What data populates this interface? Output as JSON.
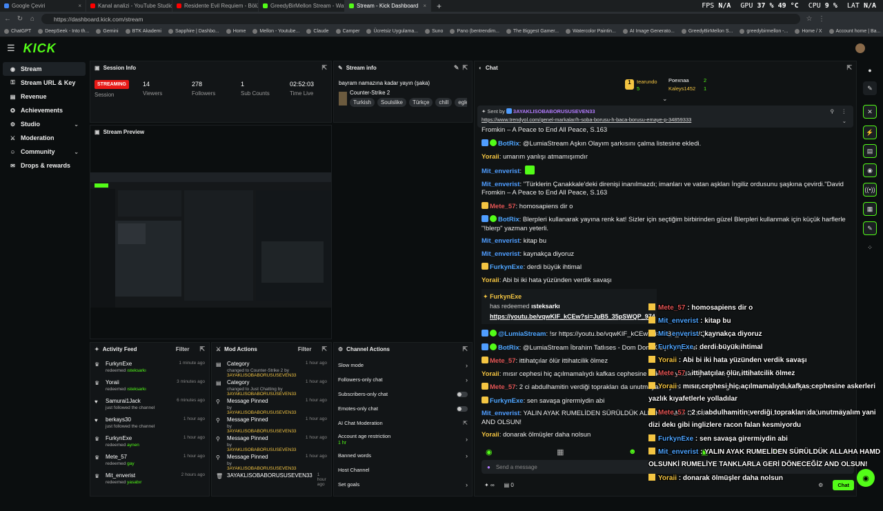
{
  "browser": {
    "tabs": [
      {
        "label": "Google Çeviri",
        "color": "#4285f4"
      },
      {
        "label": "Kanal analizi - YouTube Studio",
        "color": "#ff0000"
      },
      {
        "label": "Residente Evil Requiem - Bölüm 4",
        "color": "#ff0000"
      },
      {
        "label": "GreedyBirMellon Stream - Watch",
        "color": "#53fc18"
      },
      {
        "label": "Stream - Kick Dashboard",
        "color": "#53fc18"
      }
    ],
    "new_tab": "+",
    "url": "https://dashboard.kick.com/stream",
    "hud": {
      "fps_label": "FPS",
      "fps_value": "N/A",
      "gpu_label": "GPU",
      "gpu_value": "37 %  49 °C",
      "cpu_label": "CPU",
      "cpu_value": "9 %",
      "lat_label": "LAT",
      "lat_value": "N/A"
    },
    "bookmarks": [
      "ChatGPT",
      "DeepSeek - Into th...",
      "Gemini",
      "BTK Akademi",
      "Sapphire | Dashbo...",
      "Home",
      "Mellon - Youtube...",
      "Claude",
      "Camper",
      "Ücretsiz Uygulama...",
      "Suno",
      "Pano (bentrendim...",
      "The Biggest Gamer...",
      "Watercolor Paintin...",
      "AI Image Generato...",
      "GreedyBirMellon S...",
      "greedybirmellon -...",
      "Home / X",
      "Account home | Ba..."
    ]
  },
  "kick": {
    "logo": "KICK"
  },
  "sidebar": {
    "items": [
      {
        "label": "Stream",
        "icon": "stream-icon"
      },
      {
        "label": "Stream URL & Key",
        "icon": "key-icon"
      },
      {
        "label": "Revenue",
        "icon": "revenue-icon"
      },
      {
        "label": "Achievements",
        "icon": "trophy-icon"
      },
      {
        "label": "Studio",
        "icon": "studio-icon"
      },
      {
        "label": "Moderation",
        "icon": "sword-icon"
      },
      {
        "label": "Community",
        "icon": "community-icon"
      },
      {
        "label": "Drops & rewards",
        "icon": "gift-icon"
      }
    ]
  },
  "session_info": {
    "title": "Session Info",
    "live_badge": "STREAMING",
    "session_label": "Session",
    "viewers_value": "14",
    "viewers_label": "Viewers",
    "followers_value": "278",
    "followers_label": "Followers",
    "subs_value": "1",
    "subs_label": "Sub Counts",
    "time_value": "02:52:03",
    "time_label": "Time Live"
  },
  "stream_info": {
    "title": "Stream info",
    "stream_title": "bayram namazına kadar yayın (şaka)",
    "category": "Counter-Strike 2",
    "tags": [
      "Turkish",
      "Soulslike",
      "Türkçe",
      "chill",
      "eglenc"
    ]
  },
  "stream_preview": {
    "title": "Stream Preview"
  },
  "activity_feed": {
    "title": "Activity Feed",
    "filter": "Filter",
    "items": [
      {
        "name": "FurkynExe",
        "action": "redeemed",
        "detail": "ısteksarkı",
        "time": "1 minute ago"
      },
      {
        "name": "Yoraii",
        "action": "redeemed",
        "detail": "ısteksarkı",
        "time": "3 minutes ago"
      },
      {
        "name": "Samurai1Jack",
        "action": "just followed the channel",
        "detail": "",
        "time": "6 minutes ago"
      },
      {
        "name": "berkays30",
        "action": "just followed the channel",
        "detail": "",
        "time": "1 hour ago"
      },
      {
        "name": "FurkynExe",
        "action": "redeemed",
        "detail": "aynen",
        "time": "1 hour ago"
      },
      {
        "name": "Mete_57",
        "action": "redeemed",
        "detail": "gay",
        "time": "1 hour ago"
      },
      {
        "name": "Mit_enverist",
        "action": "redeemed",
        "detail": "yasabır",
        "time": "2 hours ago"
      }
    ]
  },
  "mod_actions": {
    "title": "Mod Actions",
    "filter": "Filter",
    "items": [
      {
        "name": "Category",
        "line": "changed to Counter-Strike 2 by",
        "by": "3AYAKLISOBABORUSUSEVEN33",
        "time": "1 hour ago"
      },
      {
        "name": "Category",
        "line": "changed to Just Chatting by",
        "by": "3AYAKLISOBABORUSUSEVEN33",
        "time": "1 hour ago"
      },
      {
        "name": "Message Pinned",
        "line": "by",
        "by": "3AYAKLISOBABORUSUSEVEN33",
        "time": "1 hour ago"
      },
      {
        "name": "Message Pinned",
        "line": "by",
        "by": "3AYAKLISOBABORUSUSEVEN33",
        "time": "1 hour ago"
      },
      {
        "name": "Message Pinned",
        "line": "by",
        "by": "3AYAKLISOBABORUSUSEVEN33",
        "time": "1 hour ago"
      },
      {
        "name": "Message Pinned",
        "line": "by",
        "by": "3AYAKLISOBABORUSUSEVEN33",
        "time": "1 hour ago"
      },
      {
        "name": "3AYAKLISOBABORUSUSEVEN33",
        "line": "",
        "by": "",
        "time": "1 hour ago"
      }
    ]
  },
  "channel_actions": {
    "title": "Channel Actions",
    "slow_mode": "Slow mode",
    "followers_only": "Followers-only chat",
    "subscribers_only": "Subscribers-only chat",
    "emotes_only": "Emotes-only chat",
    "ai_moderation": "AI Chat Moderation",
    "age_restriction": "Account age restriction",
    "age_value": "1 hr",
    "banned_words": "Banned words",
    "host_channel": "Host Channel",
    "set_goals": "Set goals"
  },
  "chat": {
    "title": "Chat",
    "leaderboard": [
      {
        "name": "tearundo",
        "score": "5"
      },
      {
        "name": "Poexnaa",
        "score": "2"
      },
      {
        "name": "Kaleys1452",
        "score": "1"
      }
    ],
    "pinned": {
      "sent_by": "Sent by",
      "user": "3AYAKLISOBABORUSUSEVEN33",
      "link": "https://www.trendyol.com/genel-markalar/h-soba-borusu-h-baca-borusu-emaye-p-34859333"
    },
    "truncated_line": "Fromkin – A Peace to End All Peace, S.163",
    "messages": [
      {
        "user": "BotRix",
        "cls": "g",
        "badge": "bot",
        "text": "@LumiaStream Aşkın Olayım şarkısını çalma listesine ekledi."
      },
      {
        "user": "Yoraii",
        "cls": "y",
        "badge": "",
        "text": "umarım yanlışı atmamışımdır"
      },
      {
        "user": "Mit_enverist",
        "cls": "b",
        "badge": "",
        "text": "[emote]"
      },
      {
        "user": "Mit_enverist",
        "cls": "b",
        "badge": "",
        "text": "\"Türklerin Çanakkale'deki direnişi inanılmazdı; imanları ve vatan aşkları İngiliz ordusunu şaşkına çevirdi.\"David Fromkin – A Peace to End All Peace, S.163"
      },
      {
        "user": "Mete_57",
        "cls": "r",
        "badge": "crown",
        "text": "homosapiens dir o"
      },
      {
        "user": "BotRix",
        "cls": "g",
        "badge": "bot",
        "text": "Blerpleri kullanarak yayına renk kat! Sizler için seçtiğim birbirinden güzel Blerpleri kullanmak için küçük harflerle \"!blerp\" yazman yeterli."
      },
      {
        "user": "Mit_enverist",
        "cls": "b",
        "badge": "",
        "text": "kitap bu"
      },
      {
        "user": "Mit_enverist",
        "cls": "b",
        "badge": "",
        "text": "kaynakça diyoruz"
      },
      {
        "user": "FurkynExe",
        "cls": "g",
        "badge": "crown",
        "text": "derdi büyük ihtimal"
      },
      {
        "user": "Yoraii",
        "cls": "y",
        "badge": "",
        "text": "Abi bi iki hata yüzünden verdik savaşı"
      }
    ],
    "redeem": {
      "user": "FurkynExe",
      "text": "has redeemed",
      "reward": "ısteksarkı",
      "link": "https://youtu.be/vqwKIF_kCEw?si=JuB5_35pSWQP_974"
    },
    "messages2": [
      {
        "user": "@LumiaStream",
        "cls": "g",
        "badge": "bot",
        "text": "!sr https://youtu.be/vqwKIF_kCEw?si=JuB5_35pSWQP_974"
      },
      {
        "user": "BotRix",
        "cls": "g",
        "badge": "bot",
        "text": "@LumiaStream İbrahim Tatlıses - Dom Dom Kurşunu çalma listesine ekledi."
      },
      {
        "user": "Mete_57",
        "cls": "r",
        "badge": "crown",
        "text": "ittihatçılar ölür ittihatcilik ölmez"
      },
      {
        "user": "Yoraii",
        "cls": "y",
        "badge": "",
        "text": "mısır cephesi hiç açılmamalıydı kafkas cephesine askerleri yazlık kıyafetlerle yolladılar"
      },
      {
        "user": "Mete_57",
        "cls": "r",
        "badge": "crown",
        "text": "2 ci abdulhamitin verdiği toprakları da unutmayalım yani dizi dekı gibi inglizlere racon falan kesmiyordu"
      },
      {
        "user": "FurkynExe",
        "cls": "g",
        "badge": "crown",
        "text": "sen savaşa girermiydin abi"
      },
      {
        "user": "Mit_enverist",
        "cls": "b",
        "badge": "",
        "text": "YALIN AYAK RUMELİDEN SÜRÜLDÜK ALLAHA HAMD OLSUNKİ RUMELİYE TANKLARLA GERİ DÖNECEĞİZ AND OLSUN!"
      },
      {
        "user": "Yoraii",
        "cls": "y",
        "badge": "",
        "text": "donarak ölmüşler daha nolsun"
      }
    ],
    "input_placeholder": "Send a message",
    "points": "∞",
    "count": "0",
    "chat_button": "Chat"
  },
  "overlay": {
    "lines": [
      {
        "user": "Mete_57",
        "cls": "or",
        "text": " : homosapiens dir o"
      },
      {
        "user": "Mit_enverist",
        "cls": "on",
        "text": " : kitap bu"
      },
      {
        "user": "Mit_enverist",
        "cls": "on",
        "text": " : kaynakça diyoruz"
      },
      {
        "user": "FurkynExe",
        "cls": "on",
        "text": " : derdi büyük ihtimal"
      },
      {
        "user": "Yoraii",
        "cls": "oy",
        "text": " : Abi bi iki hata yüzünden verdik savaşı"
      },
      {
        "user": "Mete_57",
        "cls": "or",
        "text": " : ittihatçılar ölür ittihatcilik ölmez"
      },
      {
        "user": "Yoraii",
        "cls": "oy",
        "text": " : mısır cephesi hiç açılmamalıydı kafkas cephesine askerleri"
      },
      {
        "user": "",
        "cls": "",
        "text": "yazlık kıyafetlerle yolladılar"
      },
      {
        "user": "Mete_57",
        "cls": "or",
        "text": " : 2 ci abdulhamitin verdiği toprakları da unutmayalım yani"
      },
      {
        "user": "",
        "cls": "",
        "text": "dizi dekı gibi inglizlere racon falan kesmiyordu"
      },
      {
        "user": "FurkynExe",
        "cls": "on",
        "text": " : sen savaşa girermiydin abi"
      },
      {
        "user": "Mit_enverist",
        "cls": "on",
        "text": " : YALIN AYAK RUMELİDEN SÜRÜLDÜK ALLAHA HAMD"
      },
      {
        "user": "",
        "cls": "",
        "text": "OLSUNKİ RUMELİYE TANKLARLA GERİ DÖNECEĞİZ AND OLSUN!"
      },
      {
        "user": "Yoraii",
        "cls": "oy",
        "text": " : donarak ölmüşler daha nolsun"
      }
    ]
  },
  "colors": {
    "accent": "#53fc18",
    "live": "#e91916"
  }
}
